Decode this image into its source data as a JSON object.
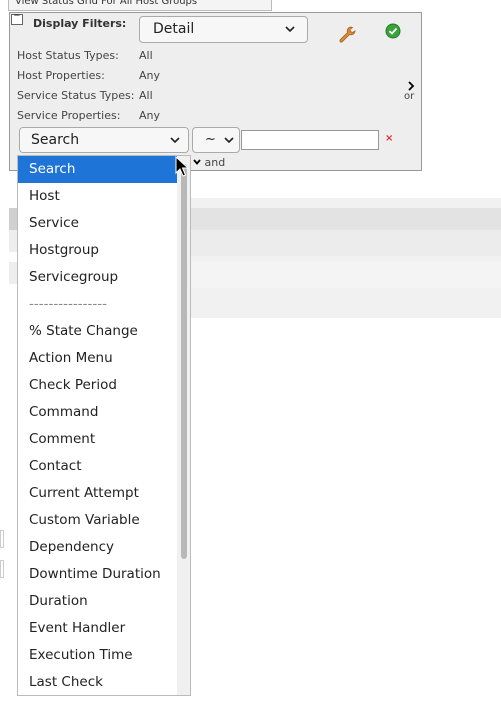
{
  "background": {
    "tab_title": "View Status Grid For All Host Groups"
  },
  "panel": {
    "title": "Display Filters:",
    "view_select": "Detail",
    "filters": [
      {
        "label": "Host Status Types:",
        "value": "All"
      },
      {
        "label": "Host Properties:",
        "value": "Any"
      },
      {
        "label": "Service Status Types:",
        "value": "All"
      },
      {
        "label": "Service Properties:",
        "value": "Any"
      }
    ],
    "or_label": "or",
    "and_label": "and",
    "search_select": "Search",
    "operator_select": "~",
    "value_input": "",
    "clear_symbol": "×"
  },
  "dropdown": {
    "options": [
      "Search",
      "Host",
      "Service",
      "Hostgroup",
      "Servicegroup",
      "----------------",
      "% State Change",
      "Action Menu",
      "Check Period",
      "Command",
      "Comment",
      "Contact",
      "Current Attempt",
      "Custom Variable",
      "Dependency",
      "Downtime Duration",
      "Duration",
      "Event Handler",
      "Execution Time",
      "Last Check"
    ],
    "selected_index": 0
  },
  "colors": {
    "selected_bg": "#1f74d8",
    "clear_icon": "#dd3333",
    "ok_icon": "#3aa33a",
    "wrench_icon": "#d98a3a"
  }
}
